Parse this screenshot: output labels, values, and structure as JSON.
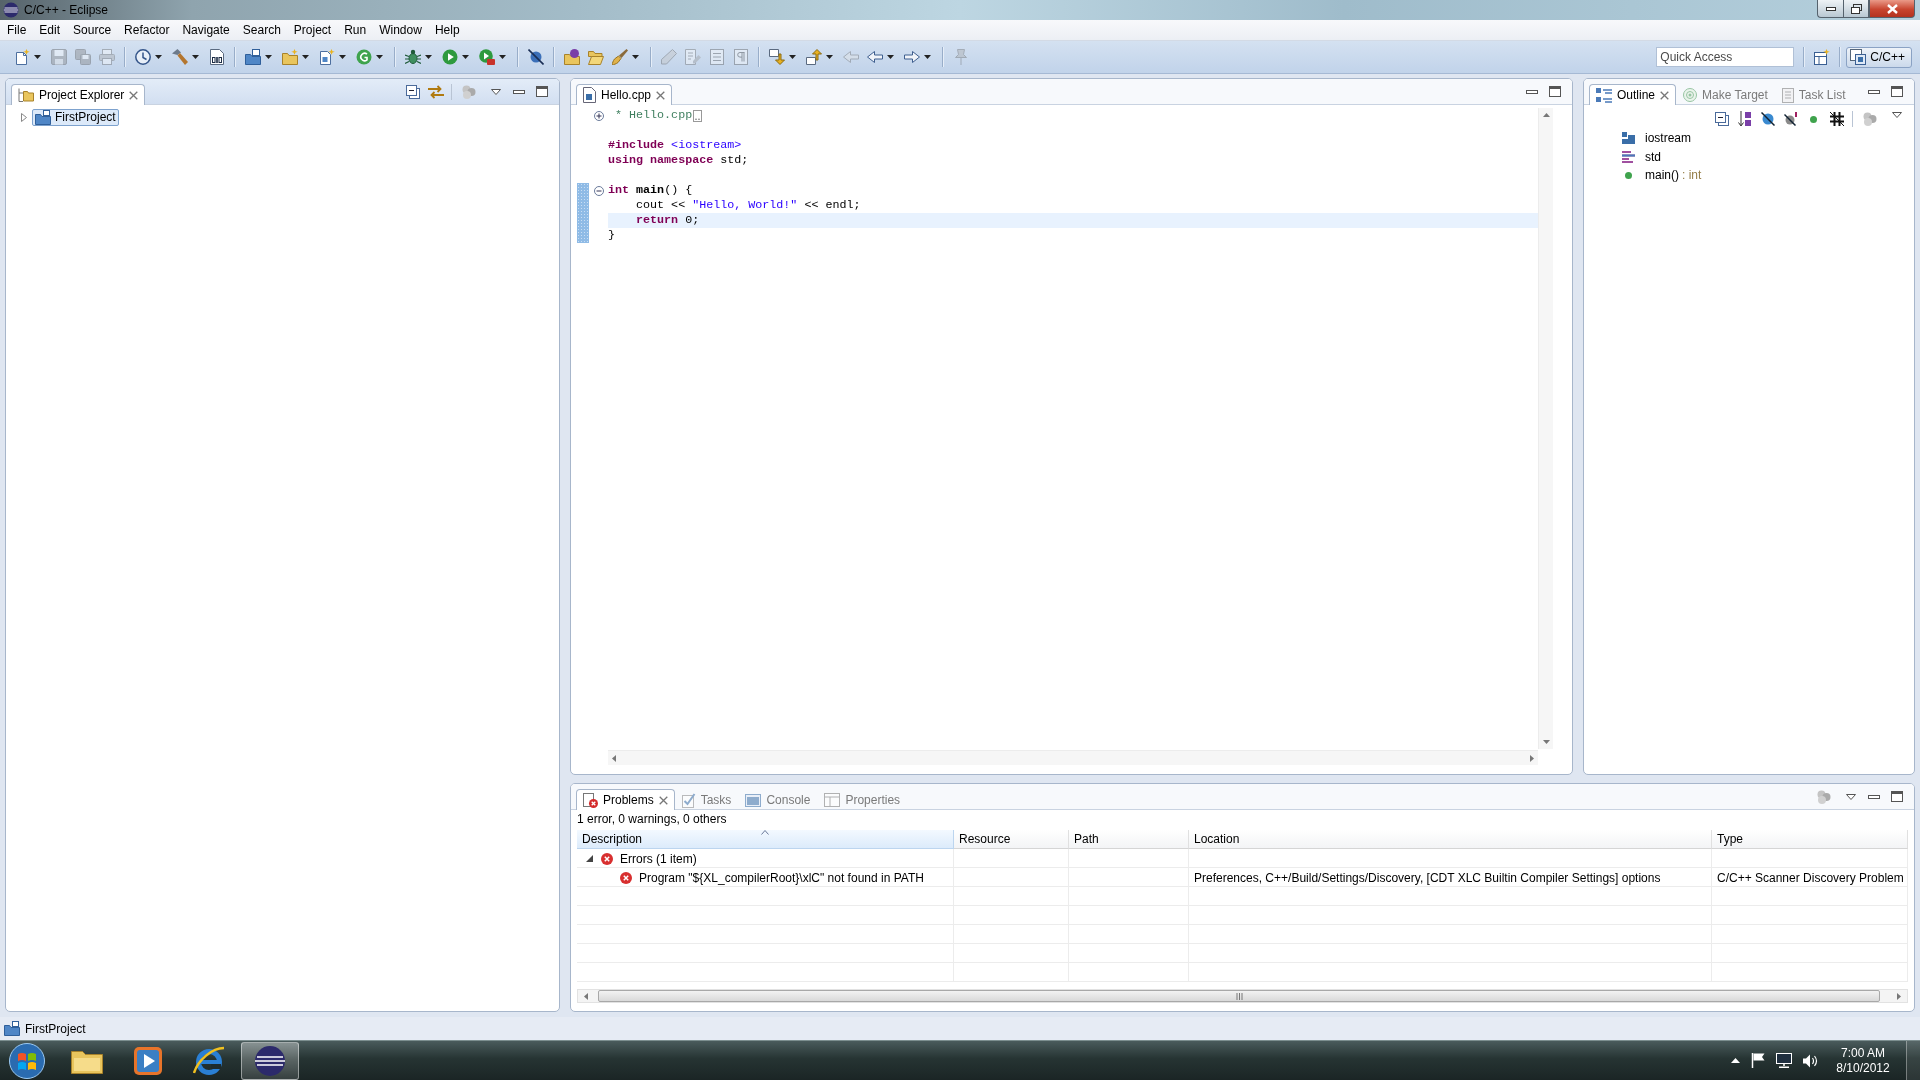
{
  "window": {
    "title": "C/C++ - Eclipse"
  },
  "menu": [
    "File",
    "Edit",
    "Source",
    "Refactor",
    "Navigate",
    "Search",
    "Project",
    "Run",
    "Window",
    "Help"
  ],
  "toolbar": {
    "groups": [
      [
        {
          "kind": "new",
          "disabled": false,
          "dropdown": true
        },
        {
          "kind": "save",
          "disabled": true,
          "dropdown": false
        },
        {
          "kind": "save_all",
          "disabled": true,
          "dropdown": false
        },
        {
          "kind": "print",
          "disabled": true,
          "dropdown": false
        }
      ],
      [
        {
          "kind": "build_config",
          "disabled": false,
          "dropdown": true
        },
        {
          "kind": "build",
          "disabled": false,
          "dropdown": true
        },
        {
          "kind": "binary",
          "disabled": false,
          "dropdown": false
        }
      ],
      [
        {
          "kind": "new_project",
          "disabled": false,
          "dropdown": true
        },
        {
          "kind": "new_folder",
          "disabled": false,
          "dropdown": true
        },
        {
          "kind": "new_file",
          "disabled": false,
          "dropdown": true
        },
        {
          "kind": "new_class",
          "disabled": false,
          "dropdown": true
        }
      ],
      [
        {
          "kind": "debug",
          "disabled": false,
          "dropdown": true
        },
        {
          "kind": "run",
          "disabled": false,
          "dropdown": true
        },
        {
          "kind": "external_tool",
          "disabled": false,
          "dropdown": true
        }
      ],
      [
        {
          "kind": "skip_breakpoints",
          "disabled": false,
          "dropdown": false
        }
      ],
      [
        {
          "kind": "open_type",
          "disabled": false,
          "dropdown": false
        },
        {
          "kind": "open_folder",
          "disabled": false,
          "dropdown": false
        },
        {
          "kind": "brush",
          "disabled": false,
          "dropdown": true
        }
      ],
      [
        {
          "kind": "pencil",
          "disabled": true,
          "dropdown": false
        },
        {
          "kind": "edit_page",
          "disabled": true,
          "dropdown": false
        },
        {
          "kind": "page_lines",
          "disabled": true,
          "dropdown": false
        },
        {
          "kind": "pilcrow",
          "disabled": true,
          "dropdown": false
        }
      ],
      [
        {
          "kind": "next_annotation",
          "disabled": false,
          "dropdown": true
        },
        {
          "kind": "prev_annotation",
          "disabled": false,
          "dropdown": true
        },
        {
          "kind": "last_edit",
          "disabled": true,
          "dropdown": false
        },
        {
          "kind": "back",
          "disabled": false,
          "dropdown": true
        },
        {
          "kind": "forward",
          "disabled": false,
          "dropdown": true
        }
      ],
      [
        {
          "kind": "pin",
          "disabled": true,
          "dropdown": false
        }
      ]
    ],
    "quick_access": {
      "placeholder": "Quick Access"
    },
    "perspectives": [
      {
        "label": "C/C++",
        "selected": true
      }
    ]
  },
  "project_explorer": {
    "active": true,
    "tabs": [
      {
        "kind": "project_explorer",
        "label": "Project Explorer",
        "selected": true
      }
    ],
    "tree": [
      {
        "label": "FirstProject",
        "expanded": false,
        "selected": true
      }
    ]
  },
  "editor": {
    "active": false,
    "tabs": [
      {
        "kind": "source_file",
        "label": "Hello.cpp",
        "selected": true
      }
    ],
    "lines": [
      {
        "collapsed": true,
        "current": false,
        "in_scope": false,
        "tokens": [
          {
            "kind": "comment",
            "text": " * Hello.cpp"
          }
        ]
      },
      {
        "current": false,
        "in_scope": false
      },
      {
        "current": false,
        "in_scope": false,
        "tokens": [
          {
            "kind": "directive",
            "text": "#include"
          },
          {
            "kind": "header",
            "text": " <iostream>"
          }
        ]
      },
      {
        "current": false,
        "in_scope": false,
        "tokens": [
          {
            "kind": "keyword",
            "text": "using namespace"
          },
          {
            "kind": "plain",
            "text": " std;"
          }
        ]
      },
      {
        "current": false,
        "in_scope": false
      },
      {
        "collapsed": false,
        "current": false,
        "in_scope": true,
        "tokens": [
          {
            "kind": "keyword",
            "text": "int"
          },
          {
            "kind": "function",
            "text": " main"
          },
          {
            "kind": "plain",
            "text": "() {"
          }
        ]
      },
      {
        "current": false,
        "in_scope": true,
        "tokens": [
          {
            "kind": "plain",
            "text": "    cout << "
          },
          {
            "kind": "string",
            "text": "\"Hello, World!\""
          },
          {
            "kind": "plain",
            "text": " << endl;"
          }
        ]
      },
      {
        "current": true,
        "in_scope": true,
        "tokens": [
          {
            "kind": "keyword",
            "text": "    return"
          },
          {
            "kind": "plain",
            "text": " 0;"
          }
        ]
      },
      {
        "current": false,
        "in_scope": true,
        "tokens": [
          {
            "kind": "plain",
            "text": "}"
          }
        ]
      }
    ]
  },
  "outline": {
    "active": false,
    "tabs": [
      {
        "kind": "outline",
        "label": "Outline",
        "selected": true
      },
      {
        "kind": "make_target",
        "label": "Make Target",
        "selected": false
      },
      {
        "kind": "task_list",
        "label": "Task List",
        "selected": false
      }
    ],
    "items": [
      {
        "kind": "include",
        "label": "iostream"
      },
      {
        "kind": "namespace",
        "label": "std"
      },
      {
        "kind": "function",
        "label": "main()",
        "return_type": ": int"
      }
    ]
  },
  "problems": {
    "active": false,
    "tabs": [
      {
        "kind": "problems",
        "label": "Problems",
        "selected": true
      },
      {
        "kind": "tasks",
        "label": "Tasks",
        "selected": false
      },
      {
        "kind": "console",
        "label": "Console",
        "selected": false
      },
      {
        "kind": "properties",
        "label": "Properties",
        "selected": false
      }
    ],
    "summary": "1 error, 0 warnings, 0 others",
    "columns": [
      {
        "label": "Description",
        "sorted": true
      },
      {
        "label": "Resource",
        "sorted": false
      },
      {
        "label": "Path",
        "sorted": false
      },
      {
        "label": "Location",
        "sorted": false
      },
      {
        "label": "Type",
        "sorted": false
      }
    ],
    "groups": [
      {
        "kind": "error",
        "label": "Errors (1 item)",
        "expanded": true,
        "children": [
          {
            "kind": "error",
            "description": "Program \"${XL_compilerRoot}\\xlC\" not found in PATH",
            "location": "Preferences, C++/Build/Settings/Discovery, [CDT XLC Builtin Compiler Settings] options",
            "type": "C/C++ Scanner Discovery Problem"
          }
        ]
      }
    ]
  },
  "status_bar": {
    "text": "FirstProject"
  },
  "taskbar": {
    "apps": [
      {
        "kind": "file_explorer",
        "selected": false
      },
      {
        "kind": "media_player",
        "selected": false
      },
      {
        "kind": "browser",
        "selected": false
      },
      {
        "kind": "eclipse",
        "selected": true
      }
    ],
    "clock": {
      "time": "7:00 AM",
      "date": "8/10/2012"
    }
  }
}
